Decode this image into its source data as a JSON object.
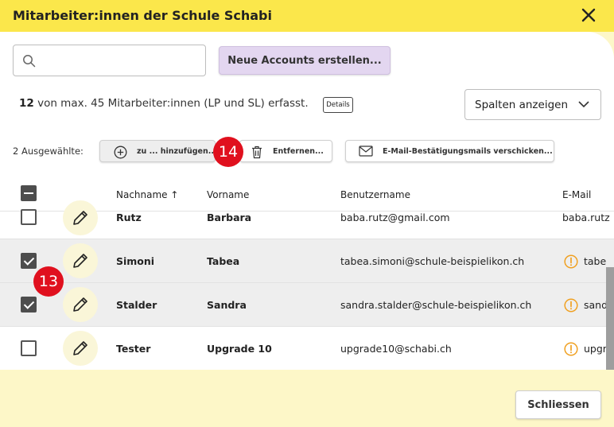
{
  "dialog": {
    "title": "Mitarbeiter:innen der Schule Schabi",
    "close_icon": "close-icon"
  },
  "toolbar": {
    "search_placeholder": "",
    "search_value": "",
    "new_accounts_label": "Neue Accounts erstellen..."
  },
  "summary": {
    "count": "12",
    "text": " von max. 45 Mitarbeiter:innen (LP und SL) erfasst.",
    "details_label": "Details",
    "columns_label": "Spalten anzeigen"
  },
  "selection": {
    "label": "2 Ausgewählte:",
    "add_label": "zu ... hinzufügen...",
    "remove_label": "Entfernen...",
    "email_label": "E-Mail-Bestätigungsmails verschicken..."
  },
  "badges": {
    "b14": "14",
    "b13": "13"
  },
  "table": {
    "headers": {
      "nachname": "Nachname",
      "sort_arrow": "↑",
      "vorname": "Vorname",
      "benutzername": "Benutzername",
      "email": "E-Mail"
    },
    "rows": [
      {
        "nachname": "Rutz",
        "vorname": "Barbara",
        "benutzername": "baba.rutz@gmail.com",
        "email": "baba.rutz",
        "selected": false,
        "warning": false
      },
      {
        "nachname": "Simoni",
        "vorname": "Tabea",
        "benutzername": "tabea.simoni@schule-beispielikon.ch",
        "email": "tabe",
        "selected": true,
        "warning": true
      },
      {
        "nachname": "Stalder",
        "vorname": "Sandra",
        "benutzername": "sandra.stalder@schule-beispielikon.ch",
        "email": "sand",
        "selected": true,
        "warning": true
      },
      {
        "nachname": "Tester",
        "vorname": "Upgrade 10",
        "benutzername": "upgrade10@schabi.ch",
        "email": "upgr",
        "selected": false,
        "warning": true
      }
    ]
  },
  "footer": {
    "close_label": "Schliessen"
  },
  "colors": {
    "header_yellow": "#fbe74b",
    "footer_yellow": "#fdf7c8",
    "badge_red": "#e0101e",
    "primary_lilac": "#e3d6f0",
    "warning_orange": "#f0a020"
  }
}
